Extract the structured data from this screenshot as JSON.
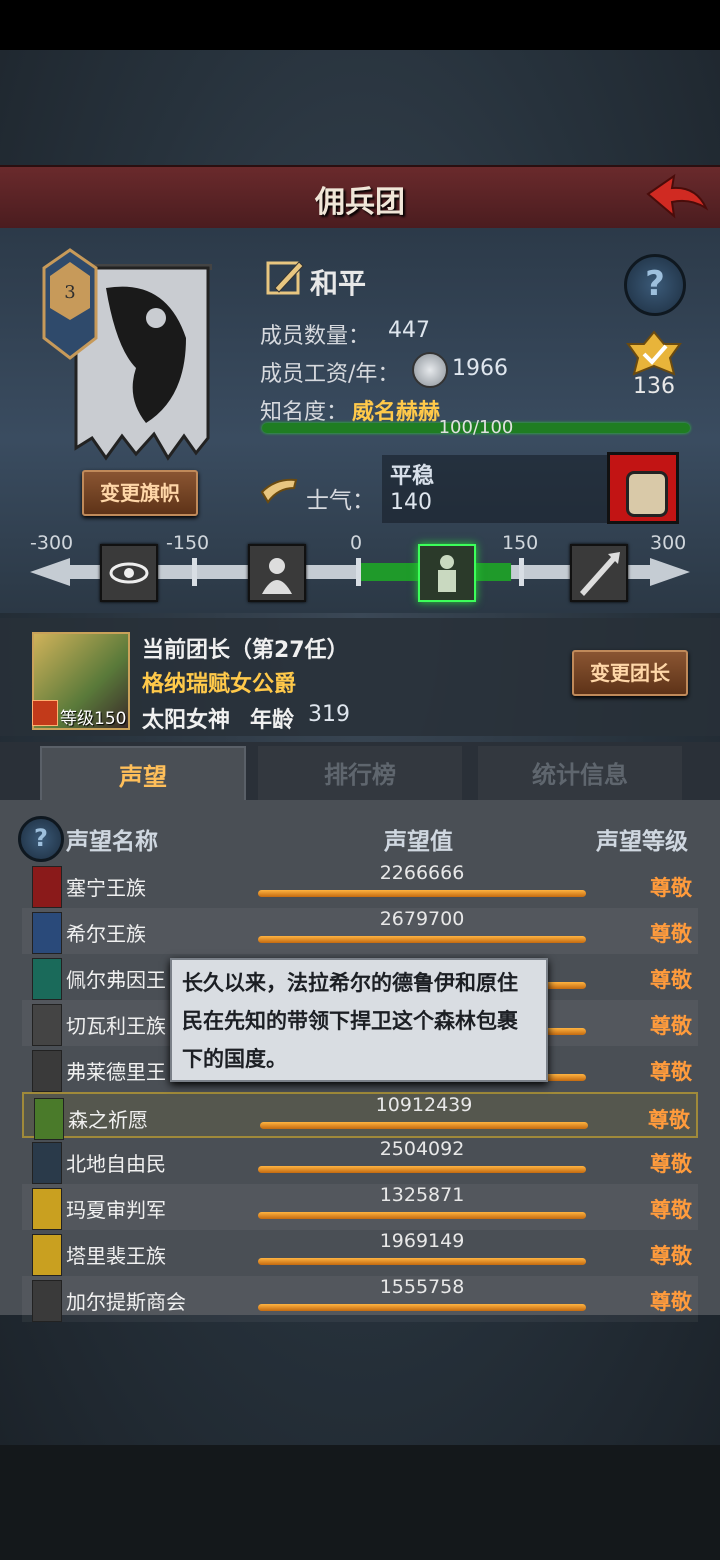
{
  "title": "佣兵团",
  "status": {
    "policy": "和平",
    "members_label": "成员数量：",
    "members_value": "447",
    "wage_label": "成员工资/年：",
    "wage_value": "1966",
    "fame_label": "知名度：",
    "fame_value": "威名赫赫",
    "fame_bar_text": "100/100",
    "fame_progress": 1.0,
    "badge_value": "136",
    "change_flag_button": "变更旗帜",
    "morale_label": "士气：",
    "morale_state": "平稳",
    "morale_value": "140"
  },
  "morale_scale": {
    "ticks": [
      "-300",
      "-150",
      "0",
      "150",
      "300"
    ],
    "current_value": 140
  },
  "leader": {
    "title_line": "当前团长（第27任）",
    "name": "格纳瑞赋女公爵",
    "level": "等级150",
    "class": "太阳女神",
    "age_label": "年龄",
    "age_value": "319",
    "change_button": "变更团长"
  },
  "tabs": [
    {
      "label": "声望"
    },
    {
      "label": "排行榜"
    },
    {
      "label": "统计信息"
    }
  ],
  "table": {
    "headers": {
      "name": "声望名称",
      "value": "声望值",
      "level": "声望等级"
    },
    "rows": [
      {
        "name": "塞宁王族",
        "value": "2266666",
        "level": "尊敬"
      },
      {
        "name": "希尔王族",
        "value": "2679700",
        "level": "尊敬"
      },
      {
        "name": "佩尔弗因王",
        "value": "",
        "level": "尊敬"
      },
      {
        "name": "切瓦利王族",
        "value": "",
        "level": "尊敬"
      },
      {
        "name": "弗莱德里王",
        "value": "",
        "level": "尊敬"
      },
      {
        "name": "森之祈愿",
        "value": "10912439",
        "level": "尊敬"
      },
      {
        "name": "北地自由民",
        "value": "2504092",
        "level": "尊敬"
      },
      {
        "name": "玛夏审判军",
        "value": "1325871",
        "level": "尊敬"
      },
      {
        "name": "塔里裴王族",
        "value": "1969149",
        "level": "尊敬"
      },
      {
        "name": "加尔提斯商会",
        "value": "1555758",
        "level": "尊敬"
      }
    ]
  },
  "tooltip": {
    "text": "长久以来，法拉希尔的德鲁伊和原住民在先知的带领下捍卫这个森林包裹下的国度。"
  },
  "colors": {
    "accent_gold": "#ffc94a",
    "level_orange": "#ff9b3c",
    "fame_green": "#1f7d22",
    "title_red": "#5a2326"
  }
}
